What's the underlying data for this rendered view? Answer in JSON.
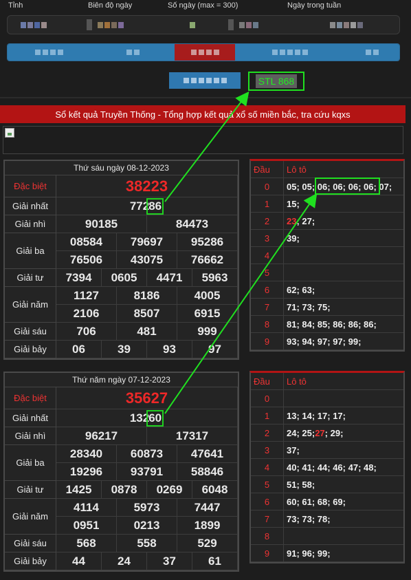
{
  "filters": {
    "tinh_label": "Tỉnh",
    "bien_do_label": "Biên độ ngày",
    "so_ngay_label": "Số ngày (max = 300)",
    "ngay_label": "Ngày trong tuần"
  },
  "banner": "Sổ kết quả Truyền Thống - Tổng hợp kết quả xổ số miền bắc, tra cứu kqxs",
  "stl_text": "STL 868",
  "results": [
    {
      "date": "Thứ sáu ngày 08-12-2023",
      "labels": [
        "Đặc biệt",
        "Giải nhất",
        "Giải nhì",
        "Giải ba",
        "Giải tư",
        "Giải năm",
        "Giải sáu",
        "Giải bảy"
      ],
      "db": "38223",
      "g1": "77286",
      "g1_a": "772",
      "g1_b": "86",
      "g2": [
        "90185",
        "84473"
      ],
      "g3": [
        "08584",
        "79697",
        "95286",
        "76506",
        "43075",
        "76662"
      ],
      "g4": [
        "7394",
        "0605",
        "4471",
        "5963"
      ],
      "g5": [
        "1127",
        "8186",
        "4005",
        "2106",
        "8507",
        "6915"
      ],
      "g6": [
        "706",
        "481",
        "999"
      ],
      "g7": [
        "06",
        "39",
        "93",
        "97"
      ]
    },
    {
      "date": "Thứ năm ngày 07-12-2023",
      "labels": [
        "Đặc biệt",
        "Giải nhất",
        "Giải nhì",
        "Giải ba",
        "Giải tư",
        "Giải năm",
        "Giải sáu",
        "Giải bảy"
      ],
      "db": "35627",
      "g1": "13260",
      "g1_a": "132",
      "g1_b": "60",
      "g2": [
        "96217",
        "17317"
      ],
      "g3": [
        "28340",
        "60873",
        "47641",
        "19296",
        "93791",
        "58846"
      ],
      "g4": [
        "1425",
        "0878",
        "0269",
        "6048"
      ],
      "g5": [
        "4114",
        "5973",
        "7447",
        "0951",
        "0213",
        "1899"
      ],
      "g6": [
        "568",
        "558",
        "529"
      ],
      "g7": [
        "44",
        "24",
        "37",
        "61"
      ]
    }
  ],
  "loto": [
    {
      "head_dau": "Đầu",
      "head_loto": "Lô tô",
      "rows": [
        {
          "d": "0",
          "v": "05; 05; 06; 06; 06; 06; 07;"
        },
        {
          "d": "1",
          "v": "15;"
        },
        {
          "d": "2",
          "red": "23",
          "v": "; 27;"
        },
        {
          "d": "3",
          "v": "39;"
        },
        {
          "d": "4",
          "v": ""
        },
        {
          "d": "5",
          "v": ""
        },
        {
          "d": "6",
          "v": "62; 63;"
        },
        {
          "d": "7",
          "v": "71; 73; 75;"
        },
        {
          "d": "8",
          "v": "81; 84; 85; 86; 86; 86;"
        },
        {
          "d": "9",
          "v": "93; 94; 97; 97; 99;"
        }
      ]
    },
    {
      "head_dau": "Đầu",
      "head_loto": "Lô tô",
      "rows": [
        {
          "d": "0",
          "v": ""
        },
        {
          "d": "1",
          "v": "13; 14; 17; 17;"
        },
        {
          "d": "2",
          "pre": "24; 25; ",
          "red": "27",
          "v": "; 29;"
        },
        {
          "d": "3",
          "v": "37;"
        },
        {
          "d": "4",
          "v": "40; 41; 44; 46; 47; 48;"
        },
        {
          "d": "5",
          "v": "51; 58;"
        },
        {
          "d": "6",
          "v": "60; 61; 68; 69;"
        },
        {
          "d": "7",
          "v": "73; 73; 78;"
        },
        {
          "d": "8",
          "v": ""
        },
        {
          "d": "9",
          "v": "91; 96; 99;"
        }
      ]
    }
  ],
  "colors": {
    "accent_red": "#b31414",
    "highlight_green": "#20e020",
    "tab_blue": "#2f7bb0"
  }
}
